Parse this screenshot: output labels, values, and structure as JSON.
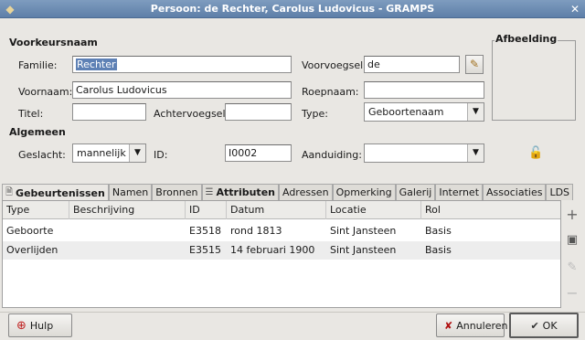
{
  "window": {
    "title": "Persoon: de Rechter, Carolus Ludovicus - GRAMPS"
  },
  "name_section": {
    "heading": "Voorkeursnaam",
    "familie_label": "Familie:",
    "familie_value": "Rechter",
    "voorvoegsel_label": "Voorvoegsel:",
    "voorvoegsel_value": "de",
    "voornaam_label": "Voornaam:",
    "voornaam_value": "Carolus Ludovicus",
    "roepnaam_label": "Roepnaam:",
    "roepnaam_value": "",
    "titel_label": "Titel:",
    "titel_value": "",
    "achtervoegsel_label": "Achtervoegsel:",
    "achtervoegsel_value": "",
    "type_label": "Type:",
    "type_value": "Geboortenaam"
  },
  "image_frame": {
    "label": "Afbeelding"
  },
  "general_section": {
    "heading": "Algemeen",
    "geslacht_label": "Geslacht:",
    "geslacht_value": "mannelijk",
    "id_label": "ID:",
    "id_value": "I0002",
    "aanduiding_label": "Aanduiding:",
    "aanduiding_value": ""
  },
  "tabs": [
    {
      "label": "Gebeurtenissen",
      "active": true
    },
    {
      "label": "Namen"
    },
    {
      "label": "Bronnen"
    },
    {
      "label": "Attributen"
    },
    {
      "label": "Adressen"
    },
    {
      "label": "Opmerking"
    },
    {
      "label": "Galerij"
    },
    {
      "label": "Internet"
    },
    {
      "label": "Associaties"
    },
    {
      "label": "LDS"
    }
  ],
  "events_table": {
    "columns": [
      "Type",
      "Beschrijving",
      "ID",
      "Datum",
      "Locatie",
      "Rol"
    ],
    "rows": [
      [
        "Geboorte",
        "",
        "E3518",
        "rond 1813",
        "Sint Jansteen",
        "Basis"
      ],
      [
        "Overlijden",
        "",
        "E3515",
        "14 februari 1900",
        "Sint Jansteen",
        "Basis"
      ]
    ]
  },
  "buttons": {
    "help": "Hulp",
    "cancel": "Annuleren",
    "ok": "OK"
  },
  "colors": {
    "titlebar": "#6d8db5",
    "selection": "#5e81b5"
  }
}
